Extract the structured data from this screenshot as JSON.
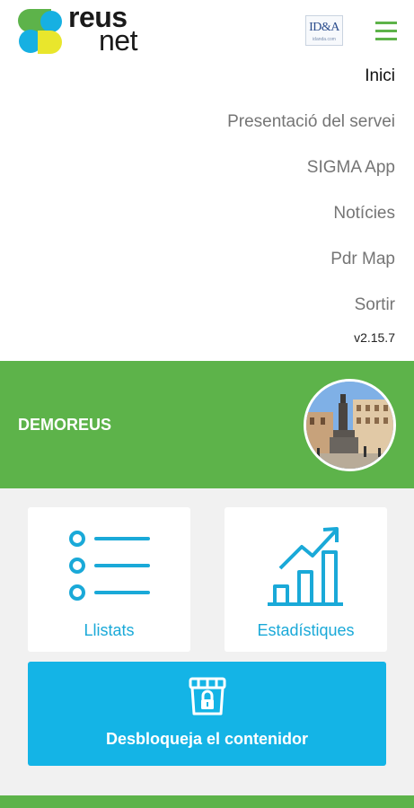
{
  "header": {
    "logo_line1": "reus",
    "logo_line2": "net",
    "partner_logo_text": "ID&A",
    "partner_logo_sub": "idanda.com"
  },
  "menu": {
    "items": [
      {
        "label": "Inici",
        "active": true
      },
      {
        "label": "Presentació del servei",
        "active": false
      },
      {
        "label": "SIGMA App",
        "active": false
      },
      {
        "label": "Notícies",
        "active": false
      },
      {
        "label": "Pdr Map",
        "active": false
      },
      {
        "label": "Sortir",
        "active": false
      }
    ],
    "version": "v2.15.7"
  },
  "user": {
    "name": "DEMOREUS"
  },
  "cards": {
    "lists_label": "Llistats",
    "stats_label": "Estadístiques"
  },
  "unlock": {
    "label": "Desbloqueja el contenidor"
  },
  "colors": {
    "brand_green": "#5db34a",
    "accent_blue": "#14b4e6",
    "card_text_blue": "#1aa9d8",
    "background_gray": "#f1f1f1"
  },
  "icons": {
    "menu": "hamburger-icon",
    "lists": "list-icon",
    "stats": "bar-chart-trend-icon",
    "unlock": "container-lock-icon"
  }
}
